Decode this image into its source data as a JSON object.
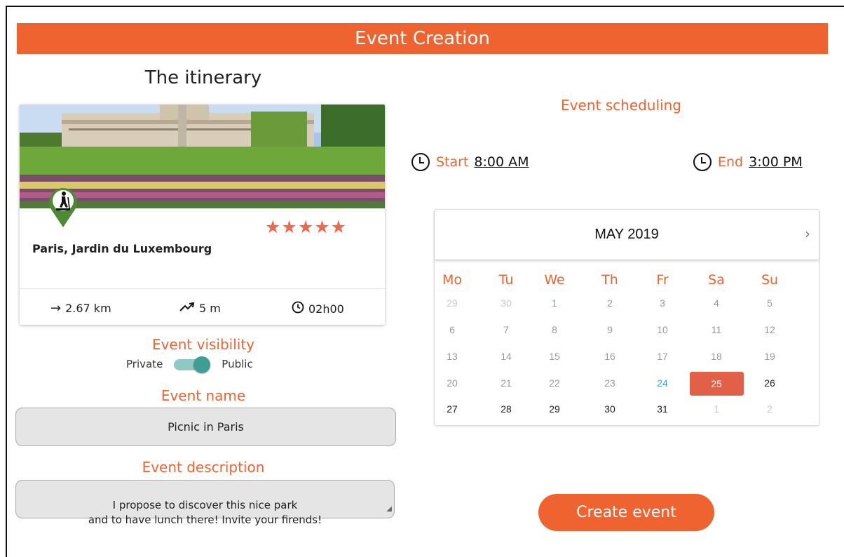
{
  "header": {
    "title": "Event Creation"
  },
  "itinerary": {
    "title": "The itinerary",
    "place": "Paris, Jardin du Luxembourg",
    "rating": 5,
    "stars": "★★★★★",
    "stats": {
      "distance": "2.67 km",
      "elevation": "5 m",
      "duration": "02h00"
    },
    "icons": {
      "distance": "arrow-right-icon",
      "elevation": "trending-up-icon",
      "duration": "clock-icon",
      "pin": "hiker-pin-icon"
    }
  },
  "visibility": {
    "label": "Event visibility",
    "off_label": "Private",
    "on_label": "Public",
    "value": "Public"
  },
  "event_name": {
    "label": "Event name",
    "value": "Picnic in Paris"
  },
  "event_description": {
    "label": "Event description",
    "value": "I propose to discover this nice park\nand to have lunch there! Invite your firends!"
  },
  "scheduling": {
    "label": "Event scheduling",
    "start_label": "Start",
    "start_value": "8:00 AM",
    "end_label": "End",
    "end_value": "3:00 PM"
  },
  "calendar": {
    "month": "MAY 2019",
    "next": "›",
    "weekdays": [
      "Mo",
      "Tu",
      "We",
      "Th",
      "Fr",
      "Sa",
      "Su"
    ],
    "weeks": [
      [
        "29",
        "30",
        "1",
        "2",
        "3",
        "4",
        "5"
      ],
      [
        "6",
        "7",
        "8",
        "9",
        "10",
        "11",
        "12"
      ],
      [
        "13",
        "14",
        "15",
        "16",
        "17",
        "18",
        "19"
      ],
      [
        "20",
        "21",
        "22",
        "23",
        "24",
        "25",
        "26"
      ],
      [
        "27",
        "28",
        "29",
        "30",
        "31",
        "1",
        "2"
      ]
    ],
    "today": "24",
    "selected": "25"
  },
  "actions": {
    "create_label": "Create event"
  },
  "colors": {
    "accent": "#ee6330",
    "toggle": "#3f9d94",
    "selected_day": "#e36048",
    "today": "#3aa0d8",
    "star": "#ec6a4e"
  }
}
